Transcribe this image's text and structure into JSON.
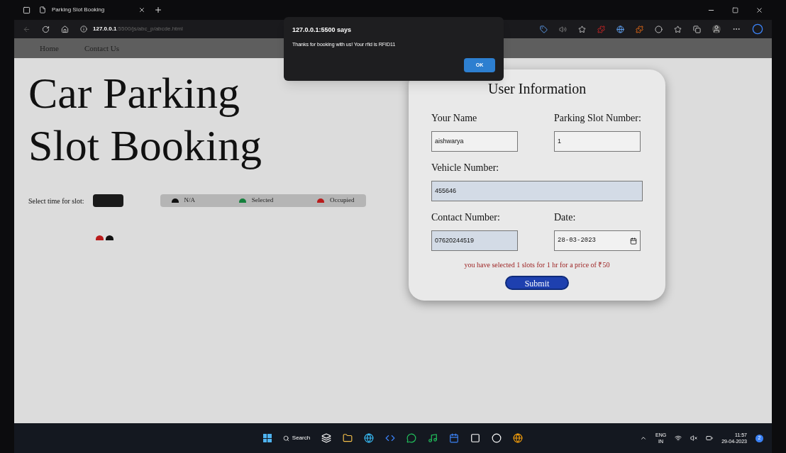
{
  "browser": {
    "tab_title": "Parking Slot Booking",
    "url_host": "127.0.0.1",
    "url_rest": ":5500/js/abc_p/abcde.html"
  },
  "nav": [
    {
      "label": "Home"
    },
    {
      "label": "Contact Us"
    }
  ],
  "heading_lines": [
    "Car Parking",
    "Slot Booking"
  ],
  "time_select": {
    "label": "Select time for slot:"
  },
  "legend": [
    {
      "label": "N/A",
      "color": "#111111"
    },
    {
      "label": "Selected",
      "color": "#15803d"
    },
    {
      "label": "Occupied",
      "color": "#b91c1c"
    }
  ],
  "seats": [
    {
      "color": "#b91c1c"
    },
    {
      "color": "#111111"
    }
  ],
  "form": {
    "title": "User Information",
    "fields": [
      {
        "label": "Your Name",
        "value": "aishwarya",
        "highlighted": false
      },
      {
        "label": "Parking Slot Number:",
        "value": "1",
        "highlighted": false
      },
      {
        "label": "Vehicle Number:",
        "value": "455646",
        "highlighted": true
      },
      {
        "label": "Contact Number:",
        "value": "07620244519",
        "highlighted": true
      },
      {
        "label": "Date:",
        "value": "28-03-2023",
        "highlighted": false,
        "kind": "date"
      }
    ],
    "summary": "you have selected 1 slots for 1 hr for a price of ₹50",
    "submit": "Submit"
  },
  "dialog": {
    "title": "127.0.0.1:5500 says",
    "message": "Thanks for booking with us! Your rfid is RFID11",
    "ok": "OK"
  },
  "taskbar": {
    "search": "Search",
    "lang_top": "ENG",
    "lang_bottom": "IN",
    "time": "11:57",
    "date": "29-04-2023",
    "notifications": "2"
  }
}
